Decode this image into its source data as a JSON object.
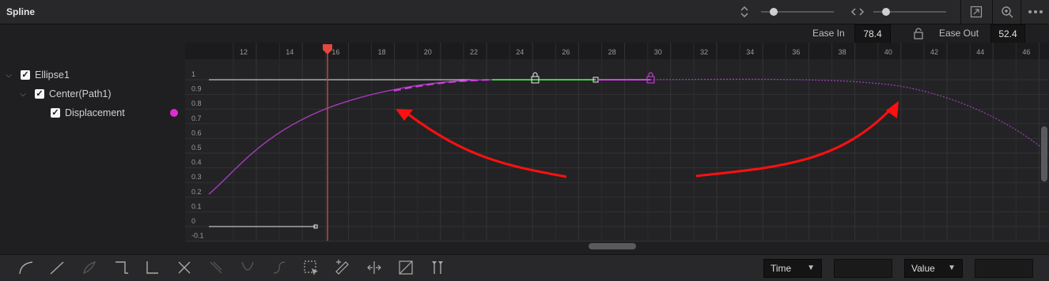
{
  "header": {
    "title": "Spline",
    "icons": [
      "sort-arrows-icon",
      "fit-horizontal-icon",
      "fit-view-icon",
      "zoom-icon",
      "more-icon"
    ]
  },
  "ease": {
    "in_label": "Ease In",
    "in_value": "78.4",
    "out_label": "Ease Out",
    "out_value": "52.4"
  },
  "tree": {
    "items": [
      {
        "label": "Ellipse1",
        "checked": true,
        "expanded": true
      },
      {
        "label": "Center(Path1)",
        "checked": true,
        "expanded": true
      },
      {
        "label": "Displacement",
        "checked": true
      }
    ],
    "curve_color": "#e22ad2"
  },
  "graph": {
    "frame_ticks": [
      "12",
      "14",
      "16",
      "18",
      "20",
      "22",
      "24",
      "26",
      "28",
      "30",
      "32",
      "34",
      "36",
      "38",
      "40",
      "42",
      "44",
      "46"
    ],
    "value_ticks": [
      "1",
      "0.9",
      "0.8",
      "0.7",
      "0.6",
      "0.5",
      "0.4",
      "0.3",
      "0.2",
      "0.1",
      "0",
      "-0.1"
    ],
    "playhead_frame": 16,
    "colors": {
      "curve": "#b43ec8",
      "selected_segment": "#3ed03e",
      "playhead": "#d9433f",
      "annotation_arrow": "#ff1010"
    }
  },
  "toolbar": {
    "tools": [
      "smooth-icon",
      "linear-icon",
      "invert-icon",
      "step-in-icon",
      "step-out-icon",
      "reverse-icon",
      "set-loop-icon",
      "ping-pong-icon",
      "relative-icon",
      "select-all-icon",
      "pencil-add-icon",
      "time-stretch-icon",
      "shape-box-icon",
      "show-keymarkers-icon"
    ],
    "time_dropdown": "Time",
    "value_dropdown": "Value",
    "time_field": "",
    "value_field": ""
  }
}
